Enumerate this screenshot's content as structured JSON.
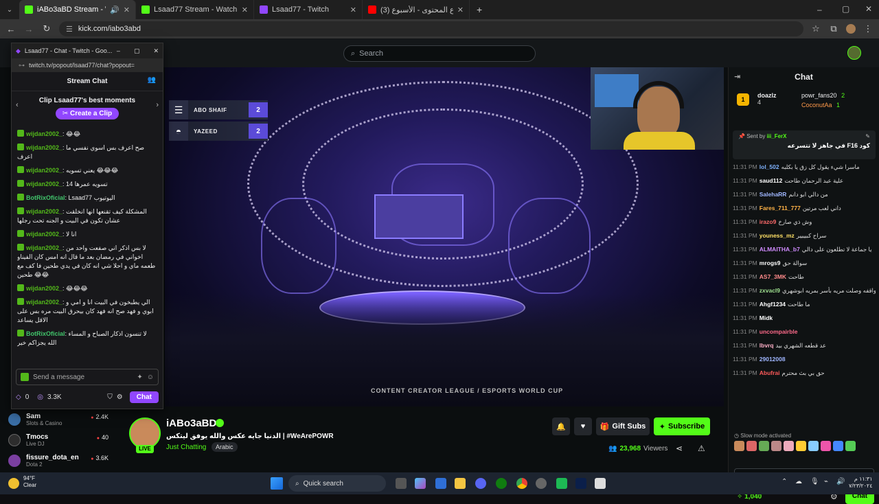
{
  "browser": {
    "tabs": [
      {
        "title": "iABo3aBD Stream - Watch L",
        "color": "#53fc18",
        "active": true
      },
      {
        "title": "Lsaad77 Stream - Watch Live o",
        "color": "#53fc18",
        "active": false
      },
      {
        "title": "Lsaad77 - Twitch",
        "color": "#9147ff",
        "active": false
      },
      {
        "title": "(3) دوري صناع المحتوى - الأسبوع",
        "color": "#ff0000",
        "active": false
      }
    ],
    "new_tab": "+",
    "url": "kick.com/iabo3abd"
  },
  "kick": {
    "search_placeholder": "Search",
    "overlay": {
      "team1": {
        "name": "ABO SHAIF",
        "score": "2"
      },
      "team2": {
        "name": "YAZEED",
        "score": "2"
      },
      "event_logo": "CONTENT CREATOR LEAGUE  /  ESPORTS WORLD CUP"
    },
    "stream": {
      "streamer": "iABo3aBD",
      "live": "LIVE",
      "title": "الدنيا جايه عكس والله يوفق ليتكس | #WeArePOWR",
      "category": "Just Chatting",
      "language": "Arabic",
      "gift_subs": "Gift Subs",
      "subscribe": "Subscribe",
      "viewers_count": "23,968",
      "viewers_label": "Viewers"
    },
    "sidebar_channels": [
      {
        "name": "Sam",
        "category": "Slots & Casino",
        "viewers": "2.4K",
        "color": "#3a6ea5"
      },
      {
        "name": "Tmocs",
        "category": "Live DJ",
        "viewers": "40",
        "color": "#2d2d2d"
      },
      {
        "name": "fissure_dota_en",
        "category": "Dota 2",
        "viewers": "3.6K",
        "color": "#7a3fa0"
      }
    ],
    "chat": {
      "title": "Chat",
      "leaders": [
        {
          "rank": "1",
          "name": "doazlz",
          "count": "4"
        },
        {
          "name": "powr_fans20",
          "count": "2"
        },
        {
          "name": "CoconutAa",
          "count": "1"
        }
      ],
      "pinned_by_label": "Sent by",
      "pinned_by": "iii_FerX",
      "pinned_msg": "في جاهز لا تتسرعه F16 كود",
      "messages": [
        {
          "time": "11:31 PM",
          "user": "lol_502",
          "color": "#7fb2ff",
          "text": "ماسرا شيء يقول كل زق يا بكلبه"
        },
        {
          "time": "11:31 PM",
          "user": "saud112",
          "color": "#ffffff",
          "text": "علية عبد الرحمان طاحت"
        },
        {
          "time": "11:31 PM",
          "user": "SalehaRR",
          "color": "#9fb6ff",
          "text": "من دالي ابو دانم"
        },
        {
          "time": "11:31 PM",
          "user": "Fares_711_777",
          "color": "#ffb347",
          "text": "داني لعب مرتين"
        },
        {
          "time": "11:31 PM",
          "user": "irazo9",
          "color": "#ff6a6a",
          "text": "وش ذي صارخ"
        },
        {
          "time": "11:31 PM",
          "user": "youness_mz",
          "color": "#ffe066",
          "text": "سراح كبيييير"
        },
        {
          "time": "11:31 PM",
          "user": "ALMAITHA_b7",
          "color": "#d08cff",
          "text": "يا جماعة لا تطلعون على دالي"
        },
        {
          "time": "11:31 PM",
          "user": "mrogs9",
          "color": "#ffffff",
          "text": "سوالة حق"
        },
        {
          "time": "11:31 PM",
          "user": "AS7_3MK",
          "color": "#ff8a8a",
          "text": "طاحت"
        },
        {
          "time": "11:31 PM",
          "user": "zxvacl9",
          "color": "#9fe08f",
          "text": "لا كانت واقفه وصلت مريه بأسر بمريه ابوشهري"
        },
        {
          "time": "11:31 PM",
          "user": "Ahgf1234",
          "color": "#ffffff",
          "text": "ما طاحت"
        },
        {
          "time": "11:31 PM",
          "user": "Midk",
          "color": "#ffffff",
          "text": ""
        },
        {
          "time": "11:31 PM",
          "user": "uncompairble",
          "color": "#ff6a8a",
          "text": ""
        },
        {
          "time": "11:31 PM",
          "user": "lbvrq",
          "color": "#ffb0c8",
          "text": "عد قطعه الشهري بيد"
        },
        {
          "time": "11:31 PM",
          "user": "29012008",
          "color": "#9fb6ff",
          "text": ""
        },
        {
          "time": "11:31 PM",
          "user": "Abufrai",
          "color": "#ff5a5a",
          "text": "حق بي بث محترم"
        }
      ],
      "slow_mode": "Slow mode activated",
      "input_placeholder": "Send a message",
      "points": "1,040",
      "chat_button": "Chat"
    }
  },
  "twitch_popup": {
    "window_title": "Lsaad77 - Chat - Twitch - Goo...",
    "url": "twitch.tv/popout/lsaad77/chat?popout=",
    "header": "Stream Chat",
    "clip_title": "Clip Lsaad77's best moments",
    "clip_button": "Create a Clip",
    "messages": [
      {
        "user": "wijdan2002_",
        "color": "#53b81a",
        "text": "😂😂"
      },
      {
        "user": "wijdan2002_",
        "color": "#53b81a",
        "text": "صح اعرف بس اسوي نفسي ما اعرف"
      },
      {
        "user": "wijdan2002_",
        "color": "#53b81a",
        "text": "يعني تسويه 😂😂😂"
      },
      {
        "user": "wijdan2002_",
        "color": "#53b81a",
        "text": "تسويه عمرها 14"
      },
      {
        "user": "BotRixOficial",
        "color": "#41c46b",
        "text": "Lsaad77 اليوتيوب"
      },
      {
        "user": "wijdan2002_",
        "color": "#53b81a",
        "text": "المشكلة كيف تقنعها انها انخلقت عشان تكون في البيت و الجنه تحت رجلها"
      },
      {
        "user": "wijdan2002_",
        "color": "#53b81a",
        "text": "انا لا"
      },
      {
        "user": "wijdan2002_",
        "color": "#53b81a",
        "text": "لا بس اذكر اني صفعت واحد من اخواني في رمضان بعد ما قال انه امس كان الفيناو طعمه ماي و احلا شي انه كان في يدي طحين فا كف مع طحين 😂😂"
      },
      {
        "user": "wijdan2002_",
        "color": "#53b81a",
        "text": "😂😂😂"
      },
      {
        "user": "wijdan2002_",
        "color": "#53b81a",
        "text": "الي يطبخون في البيت انا و امي و ابوي و فهد صح انه فهد كان بيحرق البيت مره بس على الاقل يساعد"
      },
      {
        "user": "BotRixOficial",
        "color": "#41c46b",
        "text": "لا تنسون اذكار الصباح و المساء الله يجزاكم خير"
      }
    ],
    "input_placeholder": "Send a message",
    "bits": "0",
    "points": "3.3K",
    "chat_button": "Chat"
  },
  "taskbar": {
    "temp": "94°F",
    "weather": "Clear",
    "search": "Quick search",
    "time": "١١:٣١ م",
    "date": "٧/٢٣/٢٠٢٤"
  }
}
